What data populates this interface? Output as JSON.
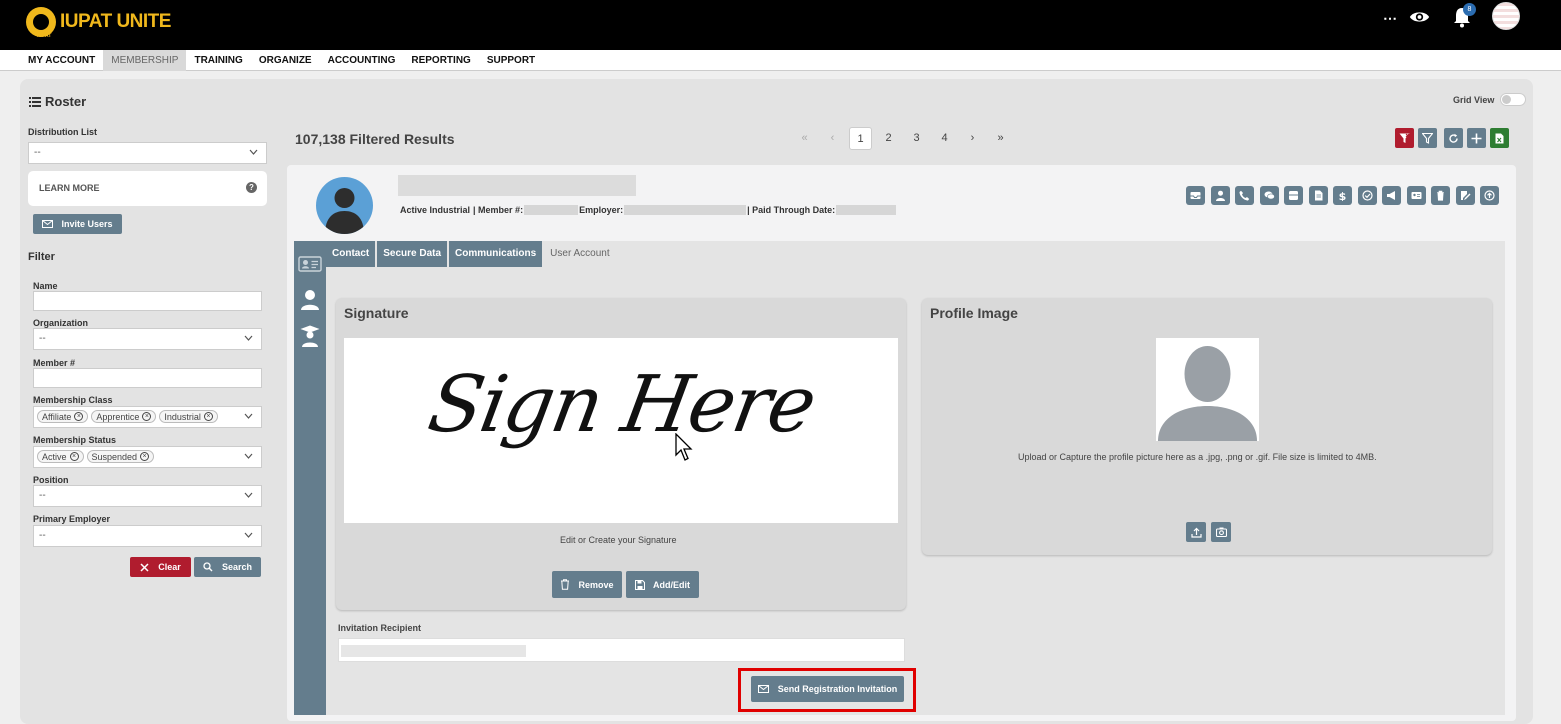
{
  "header": {
    "logo_text": "IUPAT UNITE",
    "logo_sub": "IUPAT",
    "more_label": "⋯",
    "notification_count": "8"
  },
  "nav": {
    "items": [
      {
        "label": "MY ACCOUNT",
        "active": false
      },
      {
        "label": "MEMBERSHIP",
        "active": true
      },
      {
        "label": "TRAINING",
        "active": false
      },
      {
        "label": "ORGANIZE",
        "active": false
      },
      {
        "label": "ACCOUNTING",
        "active": false
      },
      {
        "label": "REPORTING",
        "active": false
      },
      {
        "label": "SUPPORT",
        "active": false
      }
    ]
  },
  "roster": {
    "title": "Roster",
    "grid_view_label": "Grid View",
    "grid_view_on": false
  },
  "sidebar": {
    "distribution_list_label": "Distribution List",
    "distribution_list_value": "--",
    "learn_more": "LEARN MORE",
    "help_glyph": "?",
    "invite_users": "Invite Users",
    "filter_title": "Filter",
    "fields": {
      "name_label": "Name",
      "organization_label": "Organization",
      "organization_value": "--",
      "member_label": "Member #",
      "membership_class_label": "Membership Class",
      "membership_class_chips": [
        "Affiliate",
        "Apprentice",
        "Industrial"
      ],
      "membership_status_label": "Membership Status",
      "membership_status_chips": [
        "Active",
        "Suspended"
      ],
      "position_label": "Position",
      "position_value": "--",
      "primary_employer_label": "Primary Employer",
      "primary_employer_value": "--"
    },
    "clear": "Clear",
    "search": "Search"
  },
  "results": {
    "count_text": "107,138 Filtered Results",
    "pages": [
      "1",
      "2",
      "3",
      "4"
    ],
    "current_page": "1",
    "first": "«",
    "prev": "‹",
    "next": "›",
    "last": "»"
  },
  "member": {
    "status": "Active Industrial",
    "member_label": "| Member #:",
    "employer_label": "Employer:",
    "paid_label": "| Paid Through Date:"
  },
  "tabs": [
    {
      "label": "Contact",
      "active": false
    },
    {
      "label": "Secure Data",
      "active": false
    },
    {
      "label": "Communications",
      "active": false
    },
    {
      "label": "User Account",
      "active": true
    }
  ],
  "signature": {
    "title": "Signature",
    "image_text": "Sign Here",
    "hint": "Edit or Create your Signature",
    "remove": "Remove",
    "add_edit": "Add/Edit"
  },
  "profile_image": {
    "title": "Profile Image",
    "hint": "Upload or Capture the profile picture here as a .jpg, .png or .gif. File size is limited to 4MB."
  },
  "invitation": {
    "label": "Invitation Recipient",
    "send": "Send Registration Invitation"
  },
  "colors": {
    "accent": "#647d8d",
    "danger": "#b01c2e",
    "success": "#2e7d32",
    "brand": "#f0b81c",
    "highlight": "#e00000"
  }
}
